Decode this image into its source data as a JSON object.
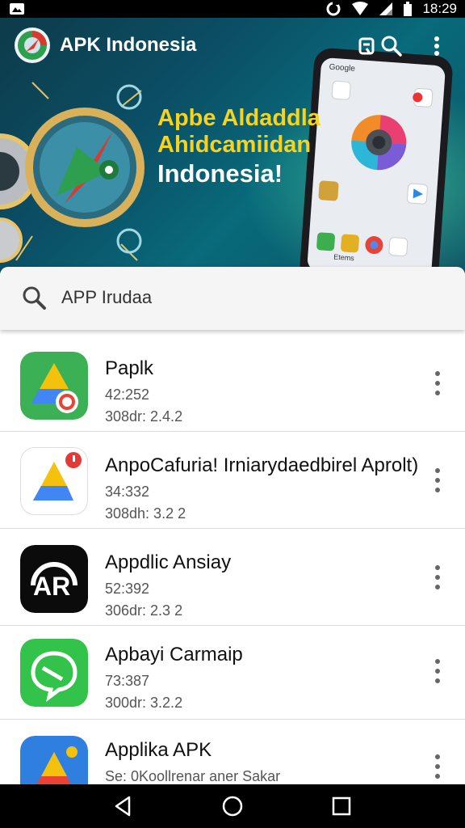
{
  "status_bar": {
    "time": "18:29"
  },
  "header": {
    "title": "APK Indonesia"
  },
  "banner": {
    "line1": "Apbe Aldaddla",
    "line2": "Ahidcamiidan",
    "line3": "Indonesia!",
    "phone_label": "Google",
    "phone_caption": "Etems"
  },
  "search": {
    "value": "APP Irudaa"
  },
  "apps": [
    {
      "name": "Paplk",
      "sub1": "42:252",
      "sub2": "308dr: 2.4.2"
    },
    {
      "name": "AnpoCafuria! Irniarydaedbirel Aprolt)",
      "sub1": "34:332",
      "sub2": "308dh: 3.2 2"
    },
    {
      "name": "Appdlic Ansiay",
      "sub1": "52:392",
      "sub2": "306dr: 2.3 2"
    },
    {
      "name": "Apbayi Carmaip",
      "sub1": "73:387",
      "sub2": "300dr: 3.2.2"
    },
    {
      "name": "Applika APK",
      "sub1": "Se: 0Koollrenar aner Sakar",
      "sub2": ""
    }
  ],
  "colors": {
    "banner_bg": "#0b4f66",
    "headline_yellow": "#f5d31e",
    "status_bar": "#000000",
    "nav_bar": "#000000"
  },
  "icons": [
    "android-icon",
    "sync-icon",
    "wifi-icon",
    "signal-icon",
    "battery-icon",
    "app-logo-icon",
    "list-view-icon",
    "search-icon",
    "more-vert-icon",
    "back-icon",
    "home-icon",
    "recents-icon"
  ]
}
